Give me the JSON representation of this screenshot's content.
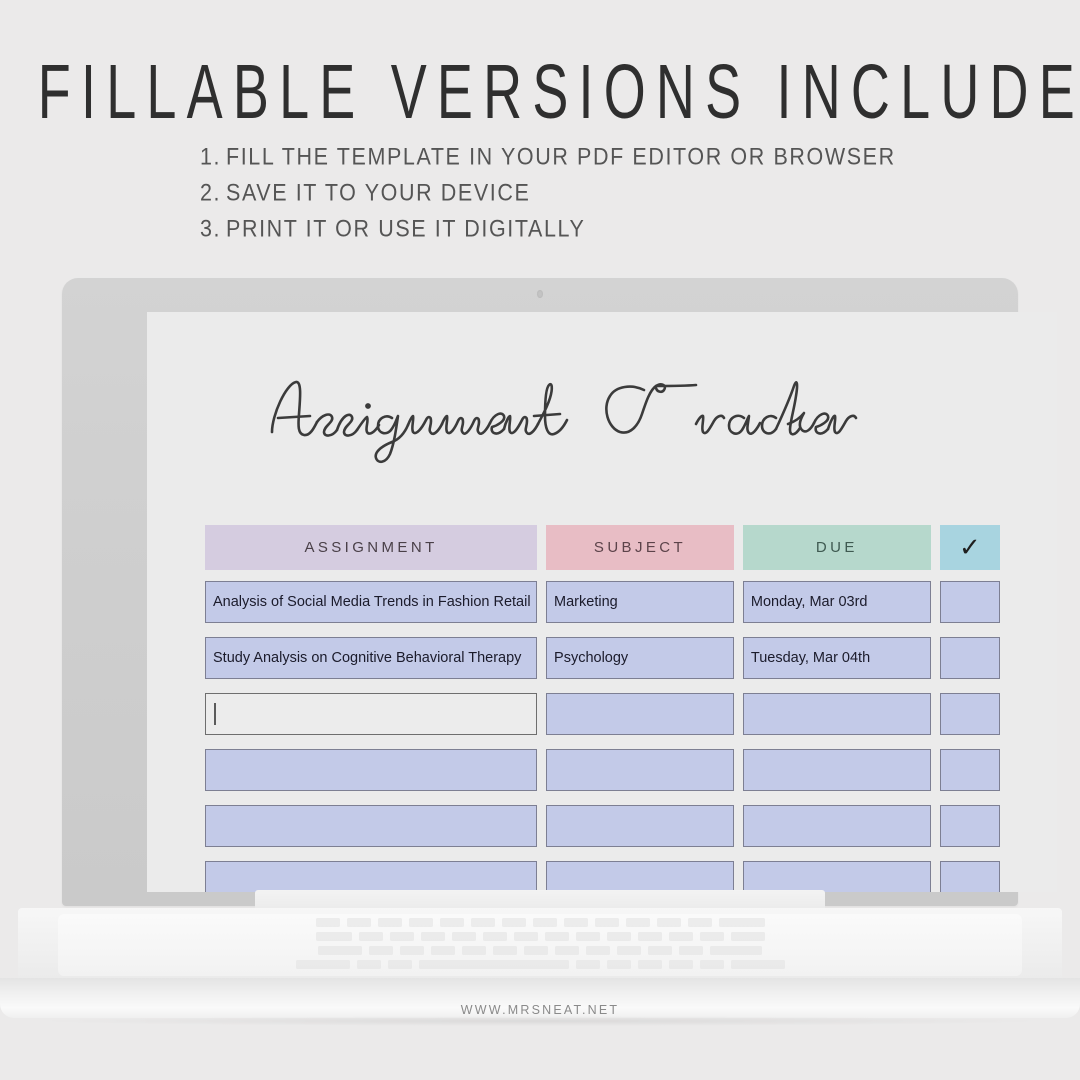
{
  "promo": {
    "title": "FILLABLE VERSIONS INCLUDED",
    "steps": [
      {
        "num": "1.",
        "text": "FILL THE TEMPLATE IN YOUR PDF EDITOR OR BROWSER"
      },
      {
        "num": "2.",
        "text": "SAVE IT TO YOUR DEVICE"
      },
      {
        "num": "3.",
        "text": "PRINT IT OR USE IT DIGITALLY"
      }
    ]
  },
  "device": {
    "type": "laptop",
    "camera": "camera-dot"
  },
  "document": {
    "title": "Assignment Tracker",
    "table": {
      "headers": [
        {
          "label": "ASSIGNMENT",
          "color": "#d5cce0"
        },
        {
          "label": "SUBJECT",
          "color": "#e8bdc5"
        },
        {
          "label": "DUE",
          "color": "#b6d8cc"
        },
        {
          "label": "✓",
          "color": "#a8d4e0"
        }
      ],
      "field_color": "#c3cae8",
      "field_border": "#7d7f93",
      "focused_field_color": "#ececec",
      "rows": [
        {
          "assignment": "Analysis of Social Media Trends in Fashion Retail",
          "subject": "Marketing",
          "due": "Monday, Mar 03rd",
          "done": "",
          "focused": false
        },
        {
          "assignment": "Study Analysis on Cognitive Behavioral Therapy",
          "subject": "Psychology",
          "due": "Tuesday, Mar 04th",
          "done": "",
          "focused": false
        },
        {
          "assignment": "",
          "subject": "",
          "due": "",
          "done": "",
          "focused": true
        },
        {
          "assignment": "",
          "subject": "",
          "due": "",
          "done": "",
          "focused": false
        },
        {
          "assignment": "",
          "subject": "",
          "due": "",
          "done": "",
          "focused": false
        },
        {
          "assignment": "",
          "subject": "",
          "due": "",
          "done": "",
          "focused": false
        },
        {
          "assignment": "",
          "subject": "",
          "due": "",
          "done": "",
          "focused": false
        }
      ]
    }
  },
  "footer": {
    "url": "WWW.MRSNEAT.NET"
  }
}
